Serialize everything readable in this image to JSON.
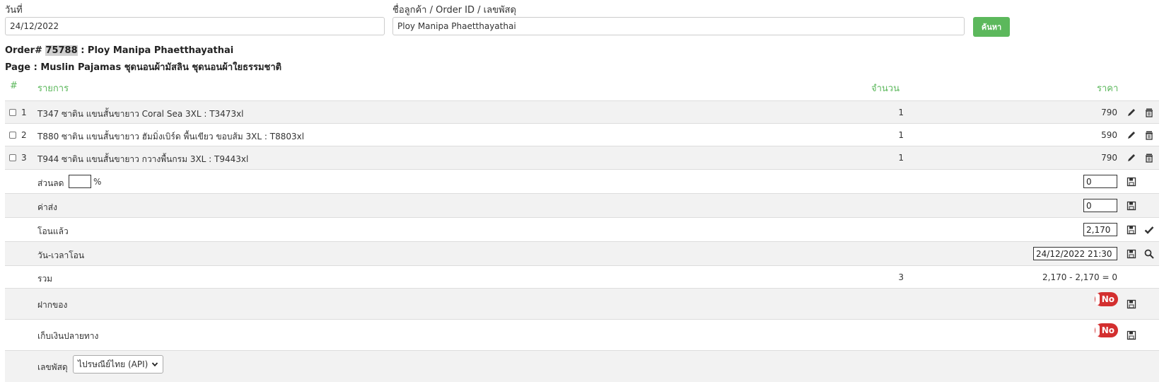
{
  "search": {
    "date_label": "วันที่",
    "date_value": "24/12/2022",
    "customer_label": "ชื่อลูกค้า / Order ID / เลขพัสดุ",
    "customer_value": "Ploy Manipa Phaetthayathai",
    "search_button": "ค้นหา"
  },
  "order": {
    "prefix": "Order#",
    "id": "75788",
    "customer": ": Ploy Manipa Phaetthayathai",
    "page_line": "Page : Muslin Pajamas ชุดนอนผ้ามัสลิน ชุดนอนผ้าใยธรรมชาติ"
  },
  "table": {
    "headers": {
      "index": "#",
      "item": "รายการ",
      "qty": "จำนวน",
      "price": "ราคา"
    },
    "rows": [
      {
        "index": "1",
        "item": "T347 ซาติน แขนสั้นขายาว Coral Sea 3XL : T3473xl",
        "qty": "1",
        "price": "790"
      },
      {
        "index": "2",
        "item": "T880 ซาติน แขนสั้นขายาว ฮัมมิ่งเบิร์ด พื้นเขียว ขอบส้ม 3XL : T8803xl",
        "qty": "1",
        "price": "590"
      },
      {
        "index": "3",
        "item": "T944 ซาติน แขนสั้นขายาว กวางพื้นกรม 3XL : T9443xl",
        "qty": "1",
        "price": "790"
      }
    ]
  },
  "summary": {
    "discount_label": "ส่วนลด",
    "discount_percent_value": "",
    "percent_sign": "%",
    "discount_value": "0",
    "shipping_label": "ค่าส่ง",
    "shipping_value": "0",
    "transferred_label": "โอนแล้ว",
    "transferred_value": "2,170",
    "transfer_time_label": "วัน-เวลาโอน",
    "transfer_time_value": "24/12/2022 21:30",
    "total_label": "รวม",
    "total_qty": "3",
    "total_calc": "2,170 - 2,170 = 0",
    "deposit_label": "ฝากของ",
    "deposit_toggle": "No",
    "cod_label": "เก็บเงินปลายทาง",
    "cod_toggle": "No",
    "tracking_label": "เลขพัสดุ",
    "tracking_option": "ไปรษณีย์ไทย (API)"
  },
  "colors": {
    "accent_green": "#5cb85c",
    "toggle_red": "#d32f2f",
    "row_gray": "#f2f2f2"
  }
}
